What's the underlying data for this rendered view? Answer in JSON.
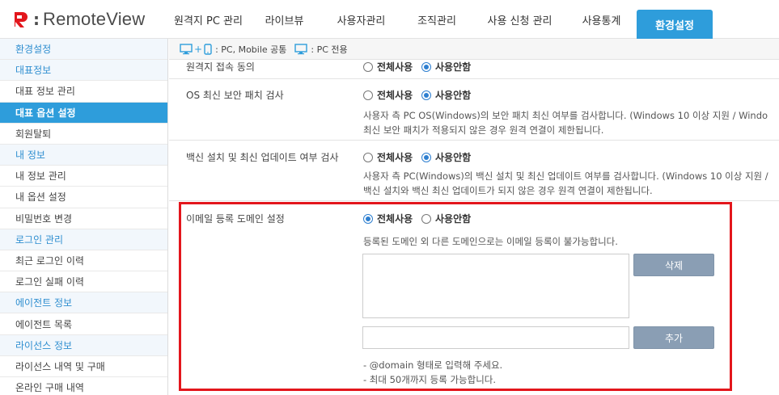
{
  "app": {
    "logo_text": "RemoteView"
  },
  "nav": {
    "items": [
      {
        "label": "원격지 PC 관리"
      },
      {
        "label": "라이브뷰"
      },
      {
        "label": "사용자관리"
      },
      {
        "label": "조직관리"
      },
      {
        "label": "사용 신청 관리"
      },
      {
        "label": "사용통계"
      },
      {
        "label": "환경설정",
        "active": true
      }
    ]
  },
  "sidebar": {
    "items": [
      {
        "label": "환경설정",
        "type": "head"
      },
      {
        "label": "대표정보",
        "type": "head"
      },
      {
        "label": "대표 정보 관리",
        "type": "item"
      },
      {
        "label": "대표 옵션 설정",
        "type": "active"
      },
      {
        "label": "회원탈퇴",
        "type": "item"
      },
      {
        "label": "내 정보",
        "type": "head"
      },
      {
        "label": "내 정보 관리",
        "type": "item"
      },
      {
        "label": "내 옵션 설정",
        "type": "item"
      },
      {
        "label": "비밀번호 변경",
        "type": "item"
      },
      {
        "label": "로그인 관리",
        "type": "head"
      },
      {
        "label": "최근 로그인 이력",
        "type": "item"
      },
      {
        "label": "로그인 실패 이력",
        "type": "item"
      },
      {
        "label": "에이전트 정보",
        "type": "head"
      },
      {
        "label": "에이전트 목록",
        "type": "item"
      },
      {
        "label": "라이선스 정보",
        "type": "head"
      },
      {
        "label": "라이선스 내역 및 구매",
        "type": "item"
      },
      {
        "label": "온라인 구매 내역",
        "type": "item"
      }
    ]
  },
  "legend": {
    "common": ": PC, Mobile 공통",
    "pc_only": ": PC 전용"
  },
  "settings": {
    "remote_consent": {
      "label": "원격지 접속 동의",
      "opt_all": "전체사용",
      "opt_none": "사용안함",
      "selected": "none"
    },
    "os_patch": {
      "label": "OS 최신 보안 패치 검사",
      "opt_all": "전체사용",
      "opt_none": "사용안함",
      "selected": "none",
      "desc1": "사용자 측 PC OS(Windows)의 보안 패치 최신 여부를 검사합니다. (Windows 10 이상 지원 / Windo",
      "desc2": "최신 보안 패치가 적용되지 않은 경우 원격 연결이 제한됩니다."
    },
    "vaccine": {
      "label": "백신 설치 및 최신 업데이트 여부 검사",
      "opt_all": "전체사용",
      "opt_none": "사용안함",
      "selected": "none",
      "desc1": "사용자 측 PC(Windows)의 백신 설치 및 최신 업데이트 여부를 검사합니다. (Windows 10 이상 지원 /",
      "desc2": "백신 설치와 백신 최신 업데이트가 되지 않은 경우 원격 연결이 제한됩니다."
    },
    "email_domain": {
      "label": "이메일 등록 도메인 설정",
      "opt_all": "전체사용",
      "opt_none": "사용안함",
      "selected": "all",
      "desc": "등록된 도메인 외 다른 도메인으로는 이메일 등록이 불가능합니다.",
      "delete_label": "삭제",
      "add_label": "추가",
      "input_value": "",
      "note1": "- @domain 형태로 입력해 주세요.",
      "note2": "- 최대 50개까지 등록 가능합니다."
    }
  },
  "colors": {
    "accent": "#2e9ddb",
    "highlight": "#e3161c",
    "button": "#8a9eb4"
  }
}
